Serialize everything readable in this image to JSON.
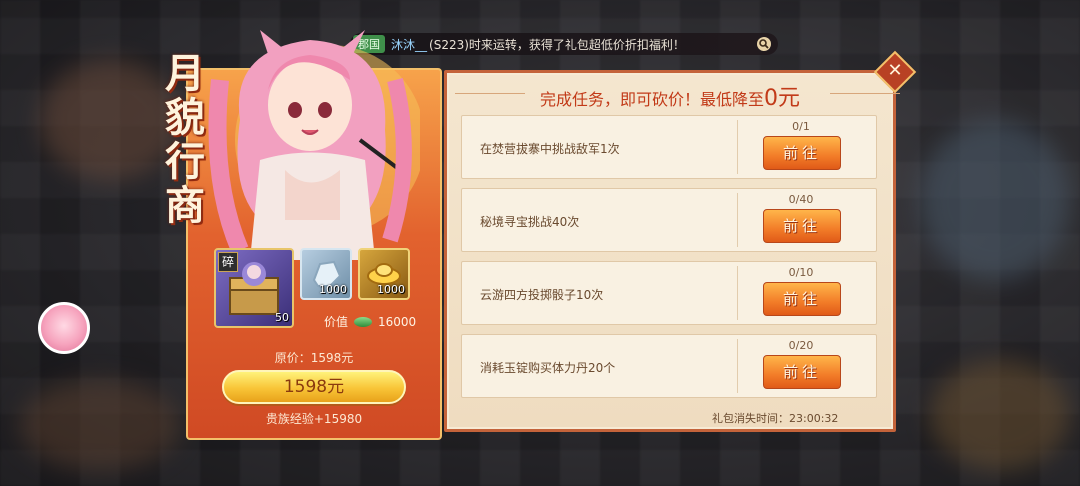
{
  "broadcast": {
    "tag": "郡国",
    "player": "沐沐__",
    "message": "(S223)时来运转，获得了礼包超低价折扣福利！",
    "search_icon": "magnifier-icon"
  },
  "gift_pack": {
    "title_chars": [
      "月",
      "貌",
      "行",
      "商"
    ],
    "items": [
      {
        "icon": "treasure-chest-fragment",
        "badge": "碎",
        "qty": "50"
      },
      {
        "icon": "silver-ore",
        "qty": "1000"
      },
      {
        "icon": "gold-ingot",
        "qty": "1000"
      }
    ],
    "value_label": "价值",
    "value_amount": "16000",
    "original_price": "原价：1598元",
    "buy_label": "1598元",
    "noble_exp": "贵族经验+15980"
  },
  "tasks_panel": {
    "heading_prefix": "完成任务，即可砍价！最低降至",
    "heading_price": "0元",
    "tasks": [
      {
        "name": "在焚营拔寨中挑战敌军1次",
        "progress": "0/1",
        "button": "前往"
      },
      {
        "name": "秘境寻宝挑战40次",
        "progress": "0/40",
        "button": "前往"
      },
      {
        "name": "云游四方投掷骰子10次",
        "progress": "0/10",
        "button": "前往"
      },
      {
        "name": "消耗玉锭购买体力丹20个",
        "progress": "0/20",
        "button": "前往"
      }
    ],
    "expire_text": "礼包消失时间：23:00:32"
  },
  "colors": {
    "accent_red": "#c23a18",
    "button_orange": "#f27c28",
    "buy_gold": "#f8c437"
  }
}
